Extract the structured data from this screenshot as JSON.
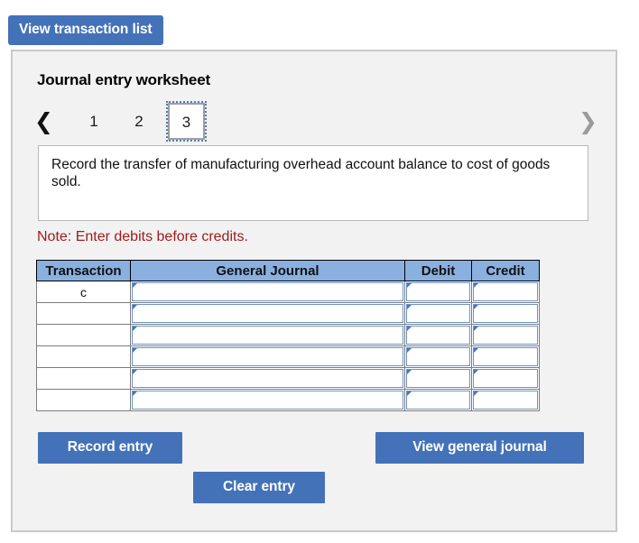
{
  "top_bar": {
    "view_transaction_list_label": "View transaction list"
  },
  "panel": {
    "title": "Journal entry worksheet",
    "pager": {
      "prev_icon": "chevron-left-icon",
      "next_icon": "chevron-right-icon",
      "tabs": [
        {
          "label": "1",
          "selected": false
        },
        {
          "label": "2",
          "selected": false
        },
        {
          "label": "3",
          "selected": true
        }
      ]
    },
    "description": "Record the transfer of manufacturing overhead account balance to cost of goods sold.",
    "note": "Note: Enter debits before credits.",
    "table": {
      "headers": [
        "Transaction",
        "General Journal",
        "Debit",
        "Credit"
      ],
      "rows": [
        {
          "transaction": "c",
          "general_journal": "",
          "debit": "",
          "credit": ""
        },
        {
          "transaction": "",
          "general_journal": "",
          "debit": "",
          "credit": ""
        },
        {
          "transaction": "",
          "general_journal": "",
          "debit": "",
          "credit": ""
        },
        {
          "transaction": "",
          "general_journal": "",
          "debit": "",
          "credit": ""
        },
        {
          "transaction": "",
          "general_journal": "",
          "debit": "",
          "credit": ""
        },
        {
          "transaction": "",
          "general_journal": "",
          "debit": "",
          "credit": ""
        }
      ]
    },
    "actions": {
      "record_entry_label": "Record entry",
      "clear_entry_label": "Clear entry",
      "view_general_journal_label": "View general journal"
    }
  },
  "colors": {
    "button_blue": "#4472b8",
    "table_header_blue": "#8ab0e0",
    "note_red": "#9e1b1b",
    "panel_bg": "#f2f2f2",
    "panel_border": "#c9c9c9",
    "field_border_blue": "#6d93c9"
  }
}
